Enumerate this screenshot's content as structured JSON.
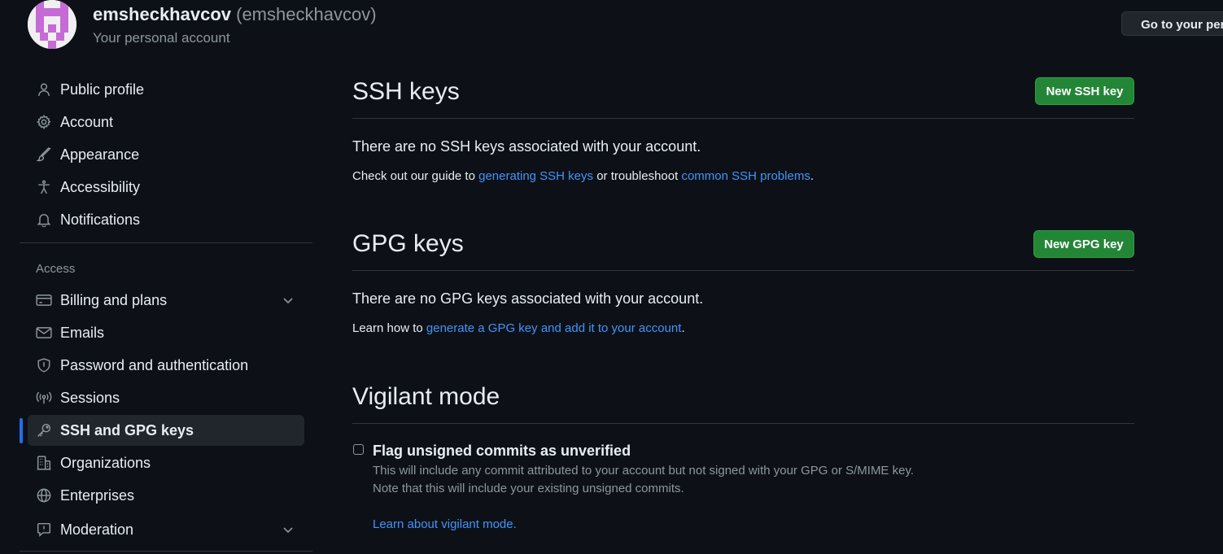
{
  "header": {
    "username": "emsheckhavcov",
    "handle": "(emsheckhavcov)",
    "subtitle": "Your personal account",
    "go_button": "Go to your perso"
  },
  "sidebar": {
    "items_top": [
      {
        "label": "Public profile",
        "icon": "person-icon"
      },
      {
        "label": "Account",
        "icon": "gear-icon"
      },
      {
        "label": "Appearance",
        "icon": "paintbrush-icon"
      },
      {
        "label": "Accessibility",
        "icon": "accessibility-icon"
      },
      {
        "label": "Notifications",
        "icon": "bell-icon"
      }
    ],
    "access_heading": "Access",
    "items_access": [
      {
        "label": "Billing and plans",
        "icon": "credit-card-icon",
        "expandable": true
      },
      {
        "label": "Emails",
        "icon": "mail-icon"
      },
      {
        "label": "Password and authentication",
        "icon": "shield-icon"
      },
      {
        "label": "Sessions",
        "icon": "broadcast-icon"
      },
      {
        "label": "SSH and GPG keys",
        "icon": "key-icon",
        "active": true
      },
      {
        "label": "Organizations",
        "icon": "organization-icon"
      },
      {
        "label": "Enterprises",
        "icon": "globe-icon"
      },
      {
        "label": "Moderation",
        "icon": "report-icon",
        "expandable": true
      }
    ]
  },
  "ssh": {
    "title": "SSH keys",
    "button": "New SSH key",
    "empty": "There are no SSH keys associated with your account.",
    "help_prefix": "Check out our guide to ",
    "help_link1": "generating SSH keys",
    "help_middle": " or troubleshoot ",
    "help_link2": "common SSH problems",
    "help_suffix": "."
  },
  "gpg": {
    "title": "GPG keys",
    "button": "New GPG key",
    "empty": "There are no GPG keys associated with your account.",
    "help_prefix": "Learn how to ",
    "help_link": "generate a GPG key and add it to your account",
    "help_suffix": "."
  },
  "vigilant": {
    "title": "Vigilant mode",
    "checkbox_label": "Flag unsigned commits as unverified",
    "checked": false,
    "note_line1": "This will include any commit attributed to your account but not signed with your GPG or S/MIME key.",
    "note_line2": "Note that this will include your existing unsigned commits.",
    "link": "Learn about vigilant mode."
  },
  "colors": {
    "background": "#0d1117",
    "link": "#4493f8",
    "green_button": "#238636",
    "active_indicator": "#1f6feb",
    "muted_text": "#8d96a0"
  }
}
